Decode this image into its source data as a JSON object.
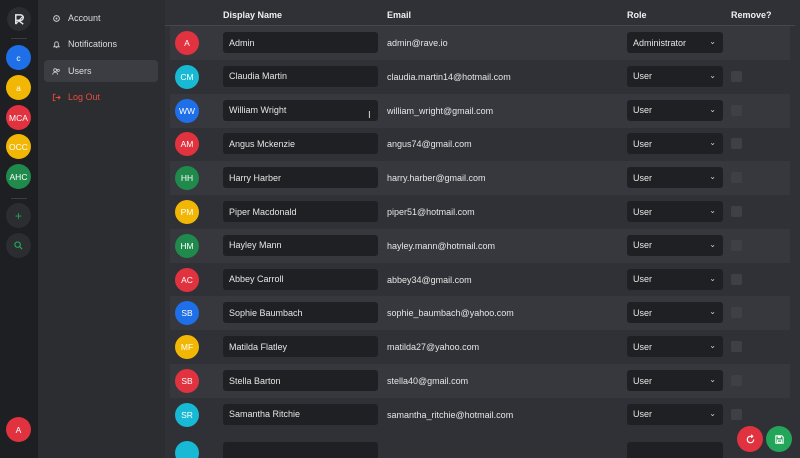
{
  "rail": {
    "logo_icon": "r-logo-icon",
    "servers": [
      {
        "label": "c",
        "color": "#1e6fe8"
      },
      {
        "label": "a",
        "color": "#f2b705"
      },
      {
        "label": "MCA",
        "color": "#e0323f"
      },
      {
        "label": "OCC",
        "color": "#f2b705"
      },
      {
        "label": "AHC",
        "color": "#1f8a4c"
      }
    ],
    "add_icon": "plus-icon",
    "search_icon": "search-icon",
    "user_avatar": {
      "label": "A",
      "color": "#e0323f"
    }
  },
  "nav": {
    "items": [
      {
        "label": "Account",
        "icon": "gear-icon"
      },
      {
        "label": "Notifications",
        "icon": "bell-icon"
      },
      {
        "label": "Users",
        "icon": "users-icon"
      },
      {
        "label": "Log Out",
        "icon": "logout-icon"
      }
    ]
  },
  "table": {
    "headers": {
      "name": "Display Name",
      "email": "Email",
      "role": "Role",
      "remove": "Remove?"
    },
    "rows": [
      {
        "initials": "A",
        "color": "#e0323f",
        "name": "Admin",
        "email": "admin@rave.io",
        "role": "Administrator",
        "removable": false
      },
      {
        "initials": "CM",
        "color": "#17b9d4",
        "name": "Claudia Martin",
        "email": "claudia.martin14@hotmail.com",
        "role": "User",
        "removable": true
      },
      {
        "initials": "WW",
        "color": "#1e6fe8",
        "name": "William Wright",
        "email": "william_wright@gmail.com",
        "role": "User",
        "removable": true
      },
      {
        "initials": "AM",
        "color": "#e0323f",
        "name": "Angus Mckenzie",
        "email": "angus74@gmail.com",
        "role": "User",
        "removable": true
      },
      {
        "initials": "HH",
        "color": "#1f8a4c",
        "name": "Harry Harber",
        "email": "harry.harber@gmail.com",
        "role": "User",
        "removable": true
      },
      {
        "initials": "PM",
        "color": "#f2b705",
        "name": "Piper Macdonald",
        "email": "piper51@hotmail.com",
        "role": "User",
        "removable": true
      },
      {
        "initials": "HM",
        "color": "#1f8a4c",
        "name": "Hayley Mann",
        "email": "hayley.mann@hotmail.com",
        "role": "User",
        "removable": true
      },
      {
        "initials": "AC",
        "color": "#e0323f",
        "name": "Abbey Carroll",
        "email": "abbey34@gmail.com",
        "role": "User",
        "removable": true
      },
      {
        "initials": "SB",
        "color": "#1e6fe8",
        "name": "Sophie Baumbach",
        "email": "sophie_baumbach@yahoo.com",
        "role": "User",
        "removable": true
      },
      {
        "initials": "MF",
        "color": "#f2b705",
        "name": "Matilda Flatley",
        "email": "matilda27@yahoo.com",
        "role": "User",
        "removable": true
      },
      {
        "initials": "SB",
        "color": "#e0323f",
        "name": "Stella Barton",
        "email": "stella40@gmail.com",
        "role": "User",
        "removable": true
      },
      {
        "initials": "SR",
        "color": "#17b9d4",
        "name": "Samantha Ritchie",
        "email": "samantha_ritchie@hotmail.com",
        "role": "User",
        "removable": true
      }
    ]
  },
  "actions": {
    "reset_icon": "reset-icon",
    "reset_color": "#e0323f",
    "save_icon": "save-icon",
    "save_color": "#23a55a"
  }
}
